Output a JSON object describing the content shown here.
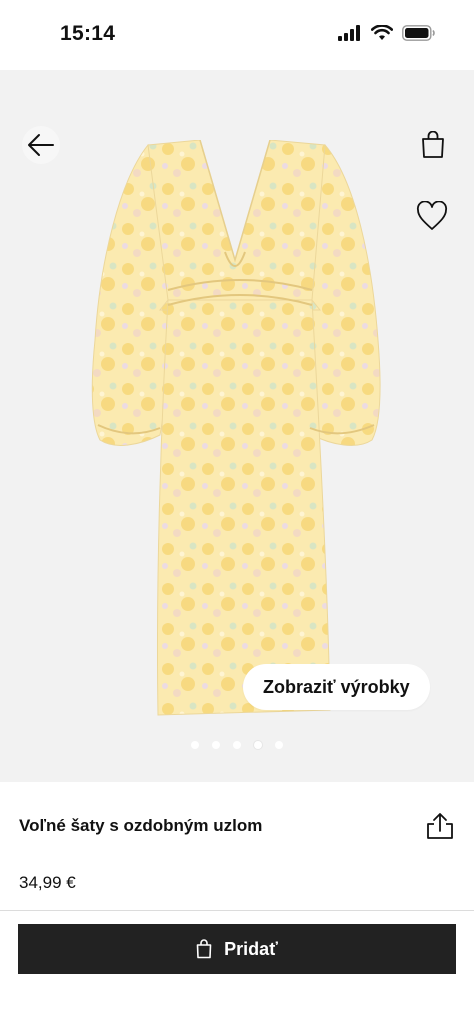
{
  "status_bar": {
    "time": "15:14"
  },
  "header": {
    "back_icon": "arrow-left-icon",
    "bag_icon": "shopping-bag-icon"
  },
  "gallery": {
    "wishlist_icon": "heart-icon",
    "show_products_label": "Zobraziť výrobky",
    "image_count": 5,
    "active_index": 3
  },
  "product": {
    "title": "Voľné šaty s ozdobným uzlom",
    "price": "34,99 €",
    "share_icon": "share-icon"
  },
  "add_button": {
    "label": "Pridať",
    "icon": "shopping-bag-icon"
  },
  "colors": {
    "button_bg": "#222222",
    "gallery_bg": "#f2f2f2"
  }
}
